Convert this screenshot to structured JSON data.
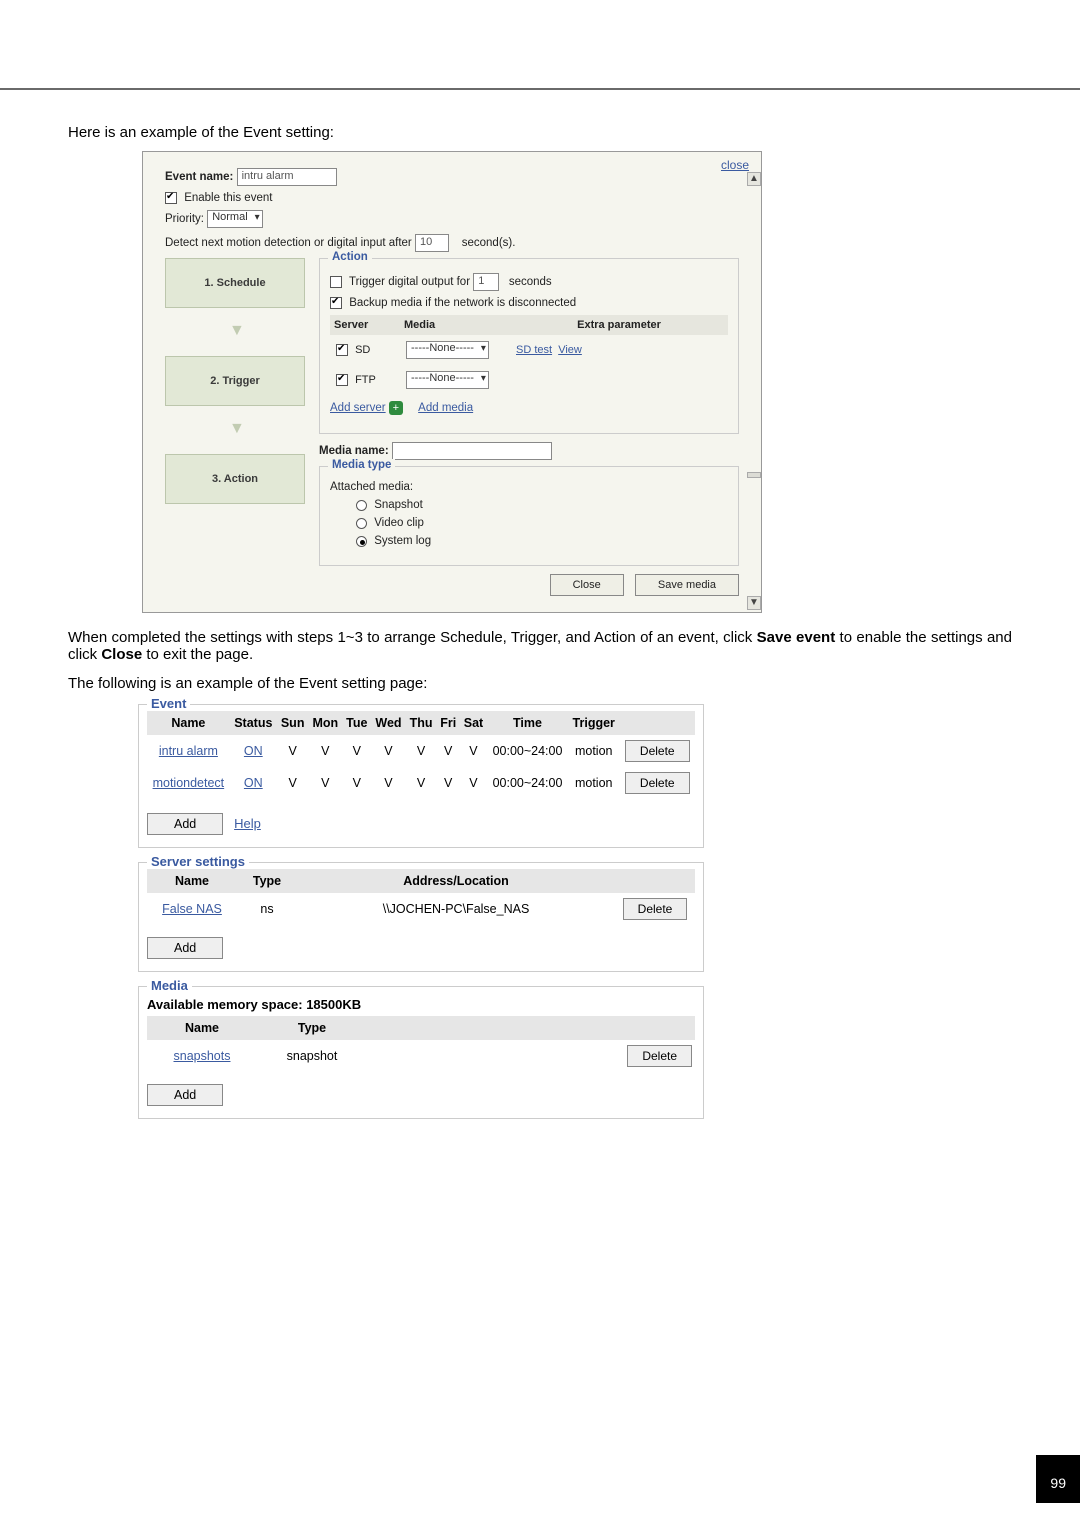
{
  "intro": "Here is an example of the Event setting:",
  "panel": {
    "closeLabel": "close",
    "eventNameLabel": "Event name:",
    "eventNameValue": "intru alarm",
    "enableThisEvent": "Enable this event",
    "priorityLabel": "Priority:",
    "priorityValue": "Normal",
    "detectPrefix": "Detect next motion detection or digital input after",
    "detectValue": "10",
    "detectSuffix": "second(s).",
    "steps": [
      "1.  Schedule",
      "2.  Trigger",
      "3.  Action"
    ],
    "action": {
      "fsTitle": "Action",
      "triggerOutPrefix": "Trigger digital output for",
      "triggerOutValue": "1",
      "triggerOutSuffix": "seconds",
      "backupMedia": "Backup media if the network is disconnected",
      "headServer": "Server",
      "headMedia": "Media",
      "headExtra": "Extra parameter",
      "rows": [
        {
          "srv": "SD",
          "media": "-----None-----",
          "extra1": "SD test",
          "extra2": "View"
        },
        {
          "srv": "FTP",
          "media": "-----None-----",
          "extra1": "",
          "extra2": ""
        }
      ],
      "addServer": "Add server",
      "addMedia": "Add media",
      "mediaNameLabel": "Media name:",
      "mediaNameValue": "",
      "mediaTypeTitle": "Media type",
      "attachedLabel": "Attached media:",
      "options": [
        "Snapshot",
        "Video clip",
        "System log"
      ],
      "selectedOption": 2,
      "btnClose": "Close",
      "btnSave": "Save media"
    }
  },
  "para1a": "When completed the settings with steps 1~3 to arrange Schedule, Trigger, and Action of an event, click ",
  "para1b": "Save event",
  "para1c": " to enable the settings and click ",
  "para1d": "Close",
  "para1e": " to exit the page.",
  "para2": "The following is an example of the Event setting page:",
  "eventBox": {
    "title": "Event",
    "cols": [
      "Name",
      "Status",
      "Sun",
      "Mon",
      "Tue",
      "Wed",
      "Thu",
      "Fri",
      "Sat",
      "Time",
      "Trigger",
      ""
    ],
    "rows": [
      {
        "name": "intru  alarm",
        "status": "ON",
        "days": [
          "V",
          "V",
          "V",
          "V",
          "V",
          "V",
          "V"
        ],
        "time": "00:00~24:00",
        "trigger": "motion",
        "del": "Delete"
      },
      {
        "name": "motiondetect",
        "status": "ON",
        "days": [
          "V",
          "V",
          "V",
          "V",
          "V",
          "V",
          "V"
        ],
        "time": "00:00~24:00",
        "trigger": "motion",
        "del": "Delete"
      }
    ],
    "add": "Add",
    "help": "Help"
  },
  "serverBox": {
    "title": "Server settings",
    "cols": [
      "Name",
      "Type",
      "Address/Location",
      ""
    ],
    "rows": [
      {
        "name": "False  NAS",
        "type": "ns",
        "addr": "\\\\JOCHEN-PC\\False_NAS",
        "del": "Delete"
      }
    ],
    "add": "Add"
  },
  "mediaBox": {
    "title": "Media",
    "avail": "Available memory space: 18500KB",
    "cols": [
      "Name",
      "Type",
      ""
    ],
    "rows": [
      {
        "name": "snapshots",
        "type": "snapshot",
        "del": "Delete"
      }
    ],
    "add": "Add"
  },
  "pageNum": "99"
}
